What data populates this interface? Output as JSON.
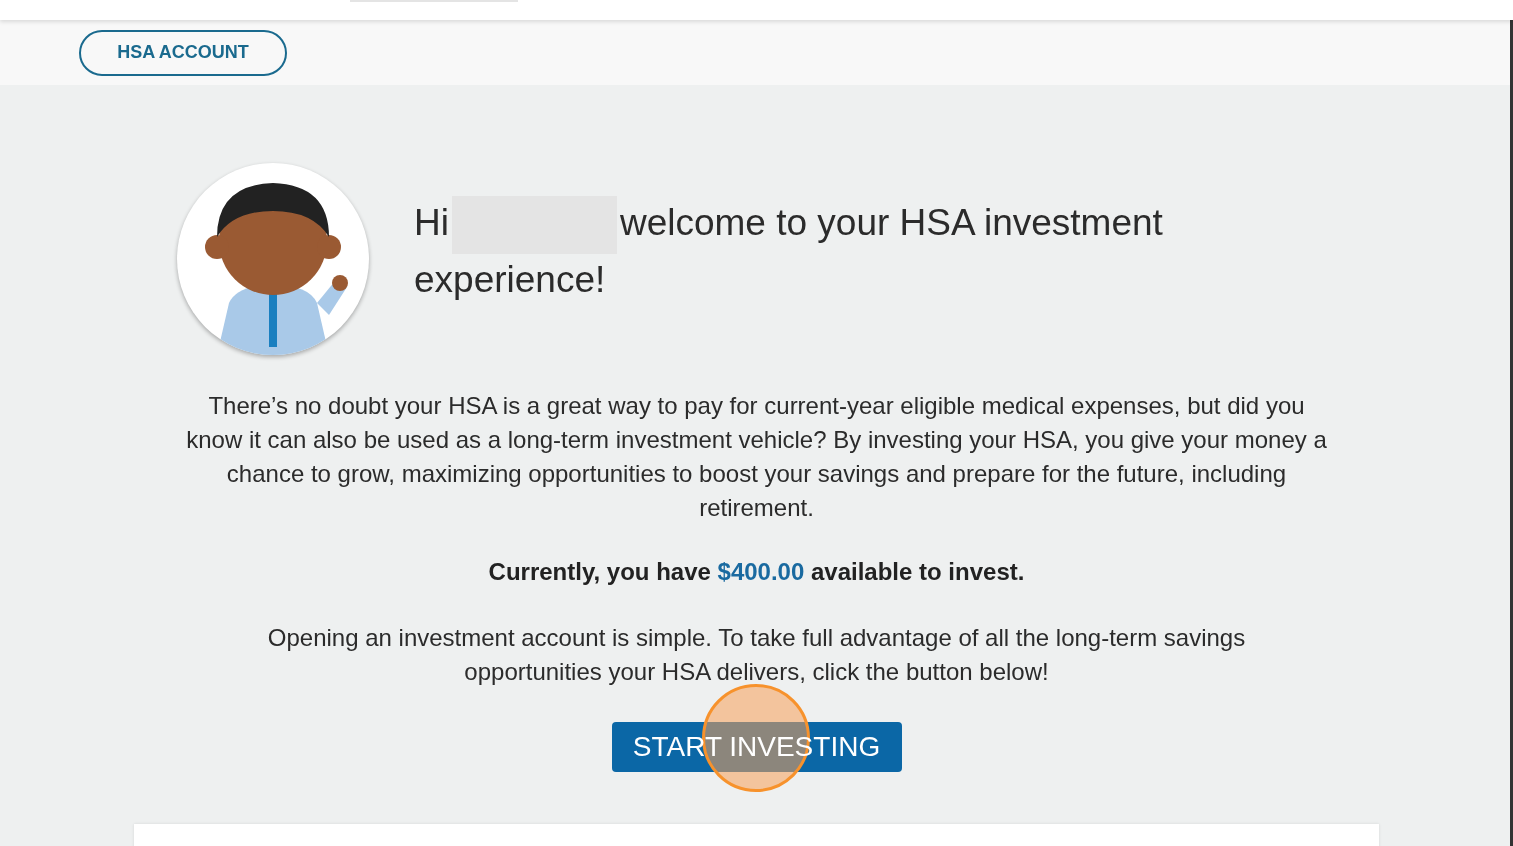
{
  "subnav": {
    "account_button": "HSA ACCOUNT"
  },
  "welcome": {
    "greeting": "Hi",
    "name_redacted": true,
    "heading": "welcome to your HSA investment experience!"
  },
  "intro": "There’s no doubt your HSA is a great way to pay for current-year eligible medical expenses, but did you know it can also be used as a long-term investment vehicle? By investing your HSA, you give your money a chance to grow, maximizing opportunities to boost your savings and prepare for the future, including retirement.",
  "available": {
    "prefix": "Currently, you have ",
    "amount": "$400.00",
    "suffix": " available to invest."
  },
  "cta_text": "Opening an investment account is simple. To take full advantage of all the long-term savings opportunities your HSA delivers, click the button below!",
  "cta_button": {
    "label": "START INVESTING",
    "click_highlight": true
  }
}
